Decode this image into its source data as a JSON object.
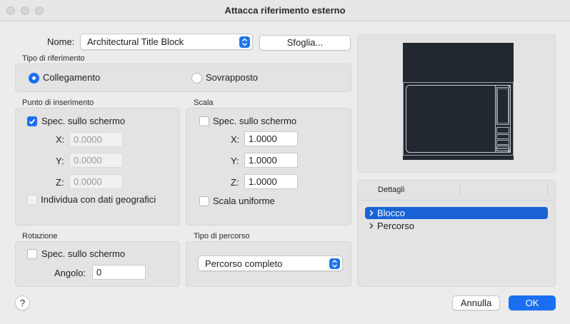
{
  "window": {
    "title": "Attacca riferimento esterno"
  },
  "name": {
    "label": "Nome:",
    "value": "Architectural Title Block",
    "browse_label": "Sfoglia..."
  },
  "ref_type": {
    "label": "Tipo di riferimento",
    "attach_label": "Collegamento",
    "overlay_label": "Sovrapposto",
    "selected": "Collegamento"
  },
  "insertion": {
    "label": "Punto di inserimento",
    "specify_label": "Spec. sullo schermo",
    "specify_checked": true,
    "x_label": "X:",
    "x_value": "0.0000",
    "y_label": "Y:",
    "y_value": "0.0000",
    "z_label": "Z:",
    "z_value": "0.0000",
    "geo_label": "Individua con dati geografici"
  },
  "scale": {
    "label": "Scala",
    "specify_label": "Spec. sullo schermo",
    "x_label": "X:",
    "x_value": "1.0000",
    "y_label": "Y:",
    "y_value": "1.0000",
    "z_label": "Z:",
    "z_value": "1.0000",
    "uniform_label": "Scala uniforme"
  },
  "rotation": {
    "label": "Rotazione",
    "specify_label": "Spec. sullo schermo",
    "angle_label": "Angolo:",
    "angle_value": "0"
  },
  "path_type": {
    "label": "Tipo di percorso",
    "value": "Percorso completo"
  },
  "details": {
    "header": "Dettagli",
    "items": [
      {
        "label": "Blocco",
        "selected": true
      },
      {
        "label": "Percorso",
        "selected": false
      }
    ]
  },
  "footer": {
    "help_label": "?",
    "cancel_label": "Annulla",
    "ok_label": "OK"
  },
  "colors": {
    "accent": "#1a6ff0",
    "preview_bg": "#212830"
  }
}
